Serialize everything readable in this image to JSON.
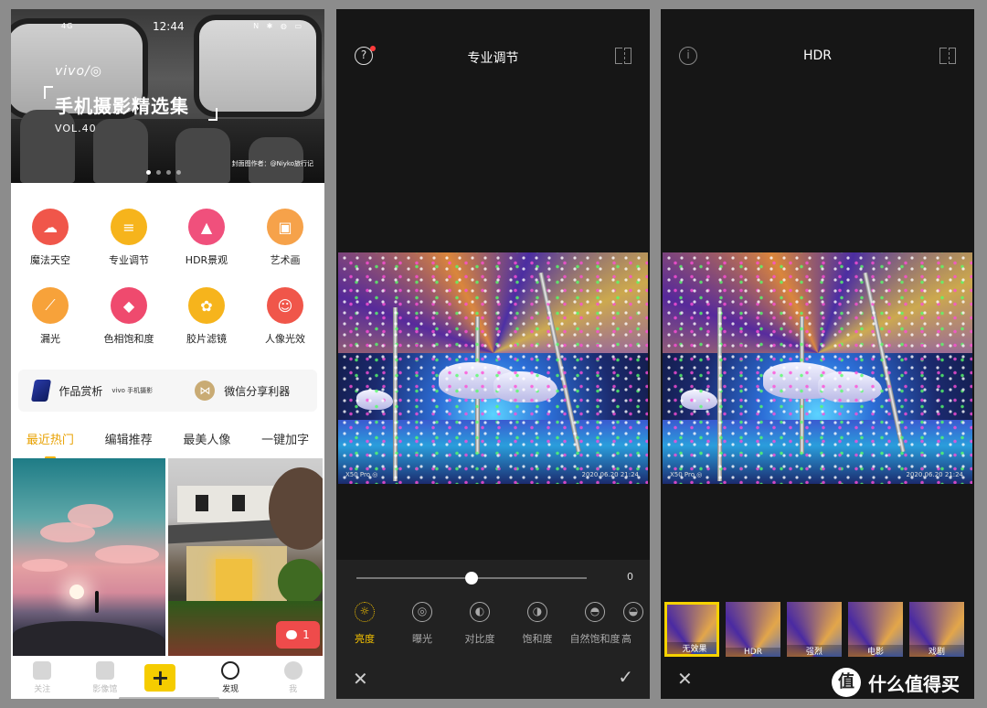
{
  "panel1": {
    "status": {
      "signal": "4G",
      "time": "12:44",
      "right_icons": "N ✱ ◍ ▭"
    },
    "banner": {
      "brand": "vivo/◎",
      "title": "手机摄影精选集",
      "vol": "VOL.40",
      "credit": "封面图作者：@Niyko旅行记",
      "pages": 4,
      "active_page": 0
    },
    "tools": [
      {
        "label": "魔法天空",
        "icon": "cloud-icon",
        "color": "#f0564a",
        "glyph": "☁"
      },
      {
        "label": "专业调节",
        "icon": "sliders-icon",
        "color": "#f6b41c",
        "glyph": "≡"
      },
      {
        "label": "HDR景观",
        "icon": "mountain-icon",
        "color": "#f0507c",
        "glyph": "▲"
      },
      {
        "label": "艺术画",
        "icon": "frame-icon",
        "color": "#f6a24a",
        "glyph": "▣"
      },
      {
        "label": "漏光",
        "icon": "light-leak-icon",
        "color": "#f7a23a",
        "glyph": "⟋"
      },
      {
        "label": "色相饱和度",
        "icon": "drop-icon",
        "color": "#ef4a6e",
        "glyph": "◆"
      },
      {
        "label": "胶片滤镜",
        "icon": "film-circles-icon",
        "color": "#f6b41c",
        "glyph": "✿"
      },
      {
        "label": "人像光效",
        "icon": "portrait-icon",
        "color": "#f0564a",
        "glyph": "☺"
      }
    ],
    "share_row": {
      "left_label": "作品赏析",
      "left_sub": "vivo 手机摄影",
      "right_label": "微信分享利器"
    },
    "tabs": [
      "最近热门",
      "编辑推荐",
      "最美人像",
      "一键加字"
    ],
    "active_tab": 0,
    "chat_badge": "1",
    "nav": [
      {
        "label": "关注",
        "icon": "follow-icon"
      },
      {
        "label": "影像馆",
        "icon": "gallery-icon"
      },
      {
        "label": "+",
        "icon": "plus-icon"
      },
      {
        "label": "发现",
        "icon": "compass-icon"
      },
      {
        "label": "我",
        "icon": "profile-icon"
      }
    ],
    "active_nav": 3
  },
  "panel2": {
    "help_glyph": "?",
    "title": "专业调节",
    "photo_watermark_left": "X50 Pro ◎",
    "photo_watermark_right": "2020.06.20 21:24",
    "slider_value": "0",
    "slider_level": 0.5,
    "adjustments": [
      {
        "label": "亮度",
        "icon": "sun-icon",
        "glyph": "☼"
      },
      {
        "label": "曝光",
        "icon": "aperture-icon",
        "glyph": "◎"
      },
      {
        "label": "对比度",
        "icon": "contrast-icon",
        "glyph": "◐"
      },
      {
        "label": "饱和度",
        "icon": "saturation-icon",
        "glyph": "◑"
      },
      {
        "label": "自然饱和度",
        "icon": "vibrance-icon",
        "glyph": "◓"
      },
      {
        "label": "高",
        "icon": "highlight-icon",
        "glyph": "◒"
      }
    ],
    "active_adjustment": 0,
    "cancel_glyph": "✕",
    "confirm_glyph": "✓"
  },
  "panel3": {
    "info_glyph": "i",
    "title": "HDR",
    "photo_watermark_left": "X50 Pro ◎",
    "photo_watermark_right": "2020.06.20 21:24",
    "filters": [
      "无效果",
      "HDR",
      "强烈",
      "电影",
      "戏剧"
    ],
    "active_filter": 0,
    "cancel_glyph": "✕"
  },
  "watermark": {
    "badge": "值",
    "text": "什么值得买"
  }
}
